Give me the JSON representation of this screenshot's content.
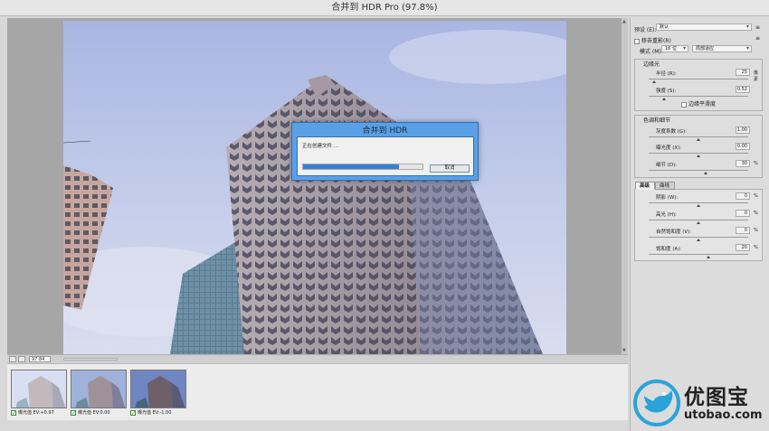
{
  "window": {
    "title": "合并到 HDR Pro (97.8%)"
  },
  "preview": {
    "zoom": "97.84"
  },
  "dialog": {
    "title": "合并到 HDR",
    "message": "正在创建文件 ...",
    "progress": 0.8,
    "cancel_label": "取消"
  },
  "filmstrip": {
    "items": [
      {
        "label": "曝光值",
        "ev": "EV:+0.97",
        "checked": true
      },
      {
        "label": "曝光值",
        "ev": "EV:0.00",
        "checked": true
      },
      {
        "label": "曝光值",
        "ev": "EV:-1.00",
        "checked": true
      }
    ]
  },
  "panel": {
    "preset_label": "预设 (E):",
    "preset_value": "默认",
    "remove_ghost_label": "移去重影(R)",
    "mode_label": "模式 (M):",
    "mode_bits": "16 位",
    "mode_method": "局部适应",
    "edge_glow": {
      "title": "边缘光",
      "radius_label": "半径 (R):",
      "radius_value": "25",
      "radius_unit": "像素",
      "radius_fraction": 0.05,
      "strength_label": "强度 (S):",
      "strength_value": "0.52",
      "strength_fraction": 0.15,
      "smooth_edges_label": "边缘平滑度"
    },
    "tone_detail": {
      "title": "色调和细节",
      "gamma_label": "灰度系数 (G):",
      "gamma_value": "1.00",
      "gamma_fraction": 0.5,
      "exposure_label": "曝光度 (X):",
      "exposure_value": "0.00",
      "exposure_fraction": 0.5,
      "detail_label": "细节 (D):",
      "detail_value": "30",
      "detail_unit": "%",
      "detail_fraction": 0.57
    },
    "advanced": {
      "tab_advanced": "高级",
      "tab_curve": "曲线",
      "shadow_label": "阴影 (W):",
      "shadow_value": "0",
      "shadow_unit": "%",
      "shadow_fraction": 0.5,
      "highlight_label": "高光 (H):",
      "highlight_value": "0",
      "highlight_unit": "%",
      "highlight_fraction": 0.5,
      "vibrance_label": "自然饱和度 (V):",
      "vibrance_value": "0",
      "vibrance_unit": "%",
      "vibrance_fraction": 0.5,
      "saturation_label": "饱和度 (A):",
      "saturation_value": "20",
      "saturation_unit": "%",
      "saturation_fraction": 0.6
    }
  },
  "watermark": {
    "name": "优图宝",
    "url": "utobao.com"
  }
}
